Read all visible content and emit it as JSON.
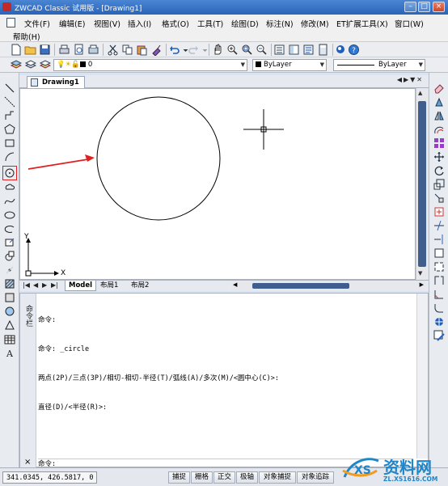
{
  "window": {
    "title": "ZWCAD Classic 试用版 - [Drawing1]"
  },
  "menu": {
    "row1": [
      "文件(F)",
      "编辑(E)",
      "视图(V)",
      "插入(I)",
      "格式(O)",
      "工具(T)",
      "绘图(D)",
      "标注(N)",
      "修改(M)",
      "ET扩展工具(X)",
      "窗口(W)"
    ],
    "row2": [
      "帮助(H)"
    ]
  },
  "properties": {
    "layer": "0",
    "color": "ByLayer",
    "linetype": "ByLayer"
  },
  "drawing_tab": "Drawing1",
  "layout_tabs": [
    "Model",
    "布局1",
    "布局2"
  ],
  "axes": {
    "x": "X",
    "y": "Y"
  },
  "command": {
    "panel_label": "命令栏",
    "lines": [
      "命令:",
      "命令: _circle",
      "两点(2P)/三点(3P)/相切-相切-半径(T)/弧线(A)/多次(M)/<圆中心(C)>:",
      "直径(D)/<半径(R)>:"
    ],
    "prompt": "命令:",
    "close": "×"
  },
  "status": {
    "coordinates": "341.0345, 426.5817, 0",
    "buttons": [
      "捕捉",
      "栅格",
      "正交",
      "极轴",
      "对象捕捉",
      "对象追踪"
    ]
  },
  "watermark": {
    "name": "资料网",
    "url": "ZL.XS1616.COM"
  },
  "colors": {
    "annotation_arrow": "#e02020",
    "titlebar": "#2a63b8",
    "scroll_thumb": "#3f5e8e"
  }
}
